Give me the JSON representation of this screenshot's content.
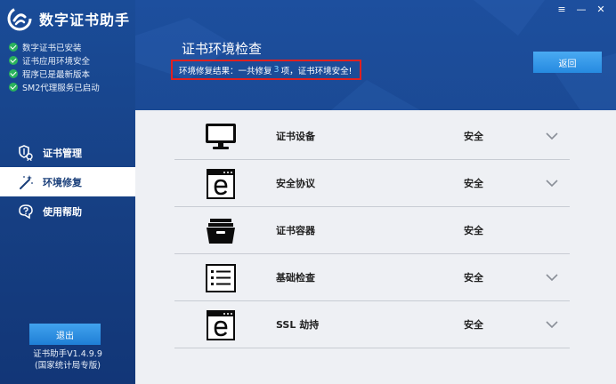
{
  "app": {
    "name": "数字证书助手",
    "version": "证书助手V1.4.9.9",
    "edition": "(国家统计局专版)"
  },
  "status_items": [
    "数字证书已安装",
    "证书应用环境安全",
    "程序已是最新版本",
    "SM2代理服务已启动"
  ],
  "nav": [
    {
      "label": "证书管理",
      "icon": "certificate-shield-icon"
    },
    {
      "label": "环境修复",
      "icon": "magic-wand-icon"
    },
    {
      "label": "使用帮助",
      "icon": "help-icon"
    }
  ],
  "logout_label": "退出",
  "window_controls": {
    "menu": "≡",
    "minimize": "—",
    "close": "✕"
  },
  "header": {
    "title": "证书环境检查",
    "result_prefix": "环境修复结果：一共修复",
    "result_count": "3",
    "result_suffix": "项，证书环境安全!",
    "back_label": "返回"
  },
  "checks": [
    {
      "name": "证书设备",
      "status": "安全",
      "icon": "monitor-icon"
    },
    {
      "name": "安全协议",
      "status": "安全",
      "icon": "browser-e-icon"
    },
    {
      "name": "证书容器",
      "status": "安全",
      "icon": "archive-box-icon"
    },
    {
      "name": "基础检查",
      "status": "安全",
      "icon": "checklist-icon"
    },
    {
      "name": "SSL 劫持",
      "status": "安全",
      "icon": "browser-e-icon"
    }
  ],
  "colors": {
    "sidebar": "#1a4c98",
    "header": "#1b4a95",
    "accent_button": "#268ae0",
    "highlight_border": "#e02020",
    "check_green": "#2bb35d"
  }
}
